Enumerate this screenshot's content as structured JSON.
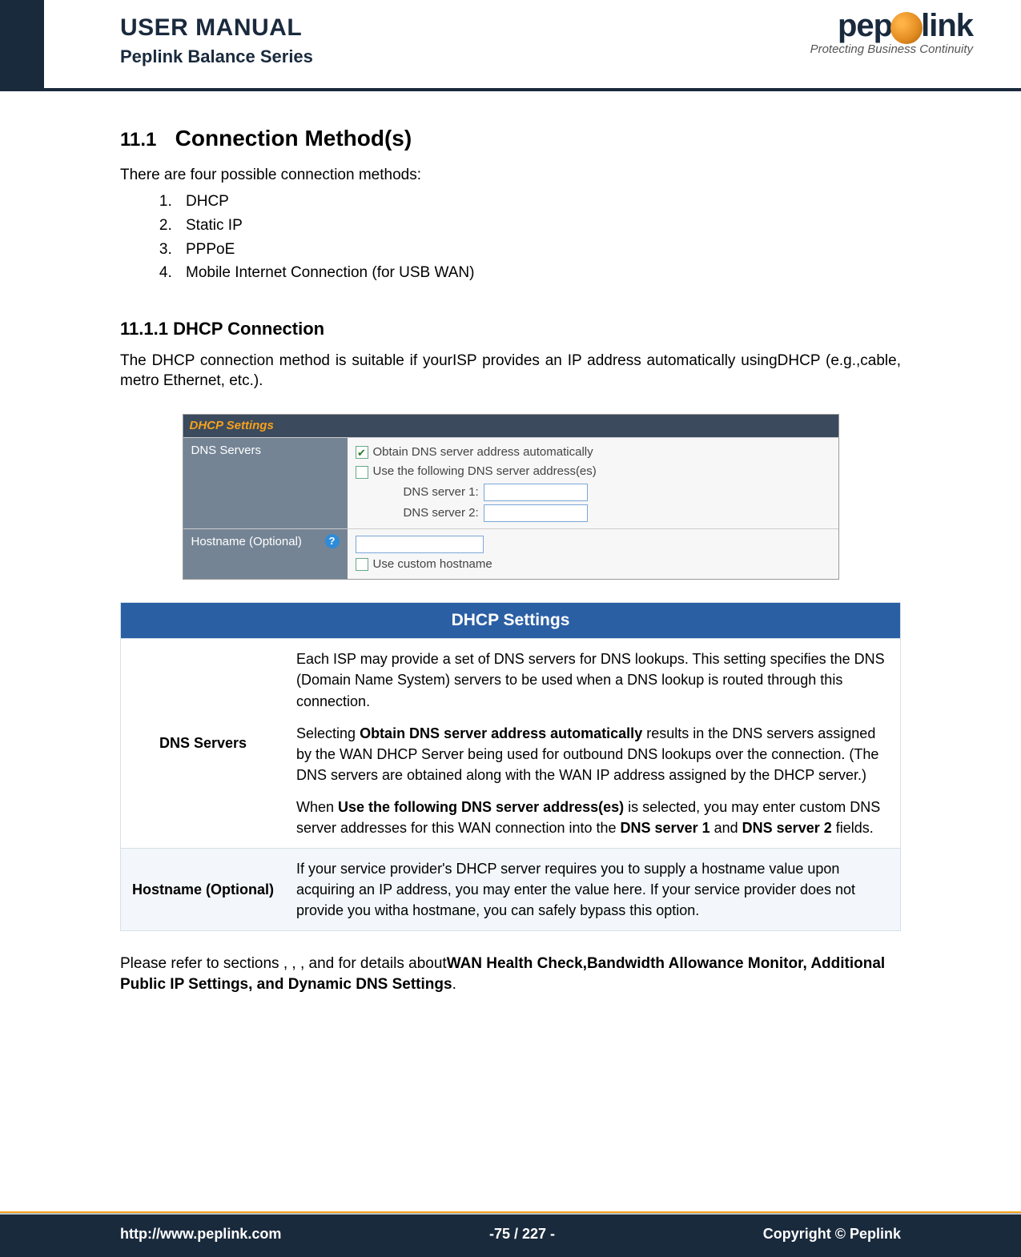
{
  "header": {
    "title": "USER MANUAL",
    "subtitle": "Peplink Balance Series",
    "logo_text_pre": "pep",
    "logo_text_post": "link",
    "logo_tagline": "Protecting Business Continuity"
  },
  "section": {
    "number": "11.1",
    "title": "Connection Method(s)",
    "intro": "There are four possible connection methods:",
    "methods": [
      "DHCP",
      "Static IP",
      "PPPoE",
      "Mobile Internet Connection (for USB WAN)"
    ]
  },
  "subsection": {
    "number_title": "11.1.1 DHCP Connection",
    "para": "The DHCP connection method is suitable if yourISP provides an IP address automatically usingDHCP (e.g.,cable, metro Ethernet, etc.)."
  },
  "ui": {
    "panel_title": "DHCP Settings",
    "row_dns_label": "DNS Servers",
    "opt_auto": "Obtain DNS server address automatically",
    "opt_manual": "Use the following DNS server address(es)",
    "dns1_label": "DNS server 1:",
    "dns2_label": "DNS server 2:",
    "row_host_label": "Hostname (Optional)",
    "opt_custom_host": "Use custom hostname"
  },
  "desc": {
    "title": "DHCP Settings",
    "rows": [
      {
        "label": "DNS Servers",
        "p1": "Each ISP may provide a set of DNS servers for DNS lookups. This setting specifies the DNS (Domain Name System) servers to be used when a DNS lookup is routed through this connection.",
        "p2a": "Selecting ",
        "p2b": "Obtain DNS server address automatically",
        "p2c": " results in the DNS servers assigned by the WAN DHCP Server being used for outbound DNS lookups over the connection. (The DNS servers are obtained along with the WAN IP address assigned by the DHCP server.)",
        "p3a": "When ",
        "p3b": "Use the following DNS server address(es)",
        "p3c": " is selected, you may enter custom DNS server addresses for this WAN connection into the ",
        "p3d": "DNS server 1",
        "p3e": " and ",
        "p3f": "DNS server 2",
        "p3g": " fields."
      },
      {
        "label": "Hostname (Optional)",
        "p1": "If your service provider's DHCP server requires you to supply a hostname value upon acquiring an IP address, you may enter the value here. If your service provider does not provide you witha hostmane, you can safely bypass this option."
      }
    ]
  },
  "refer": {
    "pre": "Please refer to sections , , , and  for details about",
    "bold": "WAN Health Check,Bandwidth Allowance Monitor, Additional Public IP Settings, and Dynamic DNS Settings",
    "post": "."
  },
  "footer": {
    "url": "http://www.peplink.com",
    "page": "-75 / 227 -",
    "copyright": "Copyright ©  Peplink"
  }
}
